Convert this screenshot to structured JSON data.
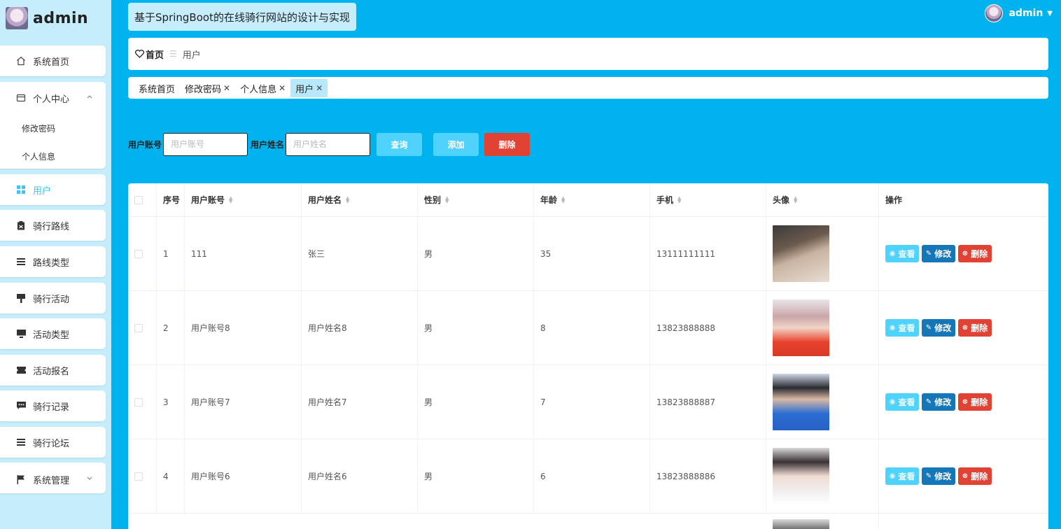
{
  "brand": {
    "name": "admin"
  },
  "sidebar": {
    "home": "系统首页",
    "personal_center": "个人中心",
    "sub_change_password": "修改密码",
    "sub_personal_info": "个人信息",
    "users": "用户",
    "routes": "骑行路线",
    "route_types": "路线类型",
    "activities": "骑行活动",
    "activity_types": "活动类型",
    "activity_signup": "活动报名",
    "records": "骑行记录",
    "forum": "骑行论坛",
    "system_mgmt": "系统管理"
  },
  "header": {
    "title": "基于SpringBoot的在线骑行网站的设计与实现",
    "username": "admin"
  },
  "breadcrumb": {
    "home": "首页",
    "current": "用户"
  },
  "tabs": [
    {
      "label": "系统首页"
    },
    {
      "label": "修改密码"
    },
    {
      "label": "个人信息"
    },
    {
      "label": "用户"
    }
  ],
  "search": {
    "account_label": "用户账号",
    "account_placeholder": "用户账号",
    "name_label": "用户姓名",
    "name_placeholder": "用户姓名",
    "query": "查询",
    "add": "添加",
    "delete": "删除"
  },
  "table": {
    "headers": {
      "index": "序号",
      "account": "用户账号",
      "name": "用户姓名",
      "gender": "性别",
      "age": "年龄",
      "phone": "手机",
      "avatar": "头像",
      "actions": "操作"
    },
    "actions": {
      "view": "查看",
      "edit": "修改",
      "delete": "删除"
    },
    "rows": [
      {
        "index": "1",
        "account": "111",
        "name": "张三",
        "gender": "男",
        "age": "35",
        "phone": "13111111111"
      },
      {
        "index": "2",
        "account": "用户账号8",
        "name": "用户姓名8",
        "gender": "男",
        "age": "8",
        "phone": "13823888888"
      },
      {
        "index": "3",
        "account": "用户账号7",
        "name": "用户姓名7",
        "gender": "男",
        "age": "7",
        "phone": "13823888887"
      },
      {
        "index": "4",
        "account": "用户账号6",
        "name": "用户姓名6",
        "gender": "男",
        "age": "6",
        "phone": "13823888886"
      }
    ]
  },
  "colors": {
    "background": "#00b2ee",
    "sidebar": "#c5edfb",
    "accent": "#4fd2fb",
    "primary_dark": "#1677b8",
    "danger": "#e04234"
  }
}
